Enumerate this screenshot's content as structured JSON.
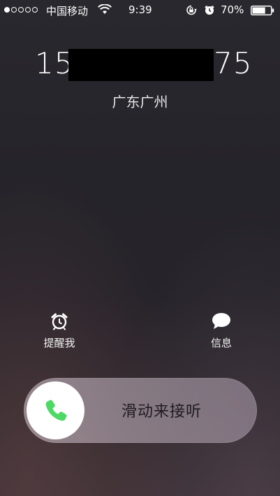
{
  "status_bar": {
    "signal_dots_filled": 1,
    "signal_dots_total": 5,
    "carrier": "中国移动",
    "time": "9:39",
    "battery_percent": "70%",
    "battery_level": 0.7
  },
  "call": {
    "number_prefix": "15",
    "number_suffix": "75",
    "location": "广东广州"
  },
  "actions": {
    "remind_label": "提醒我",
    "message_label": "信息"
  },
  "slider": {
    "label": "滑动来接听",
    "accent_color": "#4cd964"
  }
}
